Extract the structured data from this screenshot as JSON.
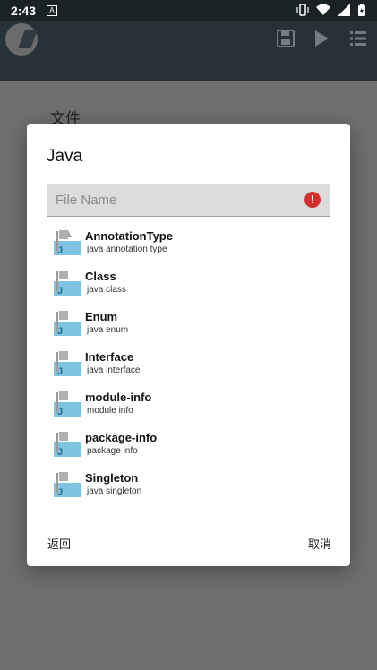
{
  "status_bar": {
    "time": "2:43",
    "notification_letter": "A"
  },
  "background": {
    "file_label": "文件"
  },
  "dialog": {
    "title": "Java",
    "filename_placeholder": "File Name",
    "error_icon_glyph": "!",
    "items": [
      {
        "name": "AnnotationType",
        "desc": "java annotation type"
      },
      {
        "name": "Class",
        "desc": "java class"
      },
      {
        "name": "Enum",
        "desc": "java enum"
      },
      {
        "name": "Interface",
        "desc": "java interface"
      },
      {
        "name": "module-info",
        "desc": "module info"
      },
      {
        "name": "package-info",
        "desc": "package info"
      },
      {
        "name": "Singleton",
        "desc": "java singleton"
      }
    ],
    "back_label": "返回",
    "cancel_label": "取消"
  },
  "colors": {
    "accent_error": "#d32f2f",
    "java_icon": "#7ec3e0",
    "dialog_bg": "#ffffff"
  },
  "icons": [
    "java-file-icon",
    "save-icon",
    "play-icon",
    "list-icon",
    "error-icon"
  ]
}
